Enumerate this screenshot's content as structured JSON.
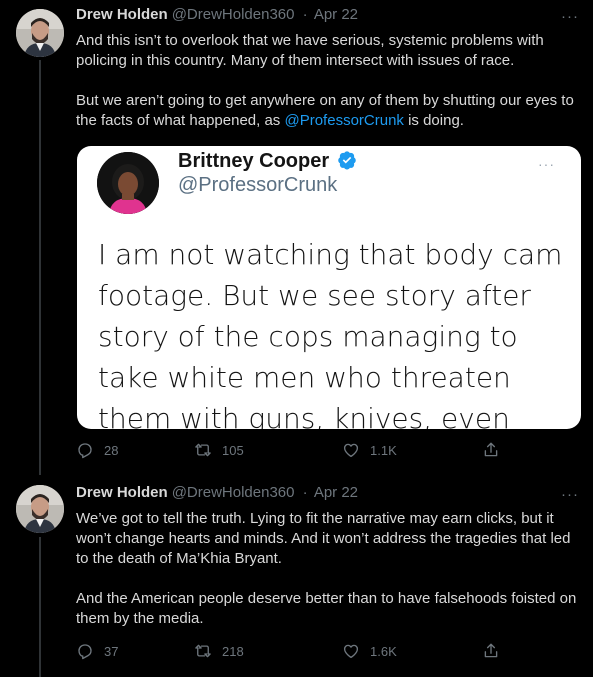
{
  "tweets": [
    {
      "author_name": "Drew Holden",
      "author_handle": "@DrewHolden360",
      "separator": "·",
      "date": "Apr 22",
      "more": "···",
      "paragraph_1": "And this isn’t to overlook that we have serious, systemic problems with policing in this country. Many of them intersect with issues of race.",
      "paragraph_2_before": "But we aren’t going to get anywhere on any of them by shutting our eyes to the facts of what happened, as ",
      "paragraph_2_mention": "@ProfessorCrunk",
      "paragraph_2_after": " is doing.",
      "embed": {
        "name": "Brittney Cooper",
        "handle": "@ProfessorCrunk",
        "more": "···",
        "text": "I am not watching that body cam footage. But we see story after story of the cops managing to take white men who threaten them with guns, knives, even ram their cars into"
      },
      "replies": "28",
      "retweets": "105",
      "likes": "1.1K"
    },
    {
      "author_name": "Drew Holden",
      "author_handle": "@DrewHolden360",
      "separator": "·",
      "date": "Apr 22",
      "more": "···",
      "paragraph_1": "We’ve got to tell the truth. Lying to fit the narrative may earn clicks, but it won’t change hearts and minds. And it won’t address the tragedies that led to the death of Ma’Khia Bryant.",
      "paragraph_2": "And the American people deserve better than to have falsehoods foisted on them by the media.",
      "replies": "37",
      "retweets": "218",
      "likes": "1.6K"
    }
  ],
  "colors": {
    "background": "#000000",
    "text": "#d9d9d9",
    "muted": "#6e767d",
    "link": "#1d9bf0",
    "verified": "#1d9bf0"
  },
  "icons": [
    "reply-icon",
    "retweet-icon",
    "like-icon",
    "share-icon",
    "verified-badge-icon",
    "more-icon"
  ]
}
